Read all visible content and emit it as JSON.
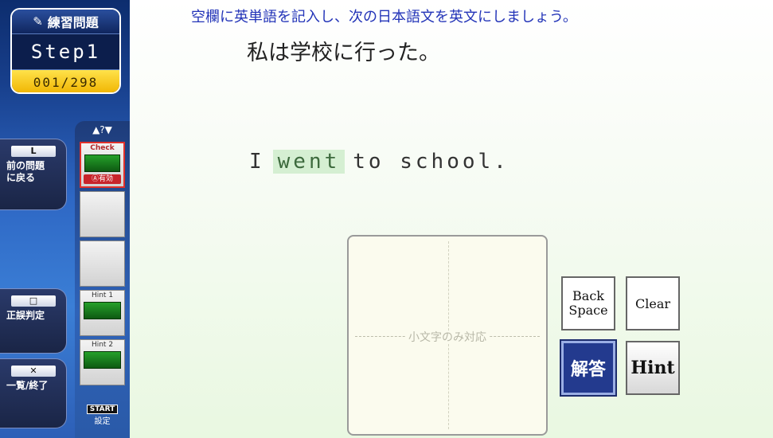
{
  "header": {
    "title": "練習問題",
    "step": "Step1",
    "progress": "001/298"
  },
  "sidebar": {
    "prev": {
      "key": "L",
      "label": "前の問題\nに戻る"
    },
    "judge": {
      "key": "□",
      "label": "正誤判定"
    },
    "exit": {
      "key": "✕",
      "label": "一覧/終了"
    }
  },
  "tools": {
    "arrows": "▲?▼",
    "check": {
      "label": "Check",
      "badge": "Ⓐ有効"
    },
    "hint1": "Hint 1",
    "hint2": "Hint 2",
    "start_key": "START",
    "start_label": "設定"
  },
  "question": {
    "instruction": "空欄に英単語を記入し、次の日本語文を英文にしましょう。",
    "japanese": "私は学校に行った。",
    "english_before": "I",
    "answer": "went",
    "english_after": "to school."
  },
  "pad": {
    "hint_text": "小文字のみ対応"
  },
  "keys": {
    "backspace": "Back\nSpace",
    "clear": "Clear",
    "answer": "解答",
    "hint": "Hint"
  },
  "colors": {
    "instruction": "#2334b8",
    "answer_bg": "#d5efd2",
    "sidebar": "#2e67c4",
    "answer_button": "#233a8e"
  }
}
